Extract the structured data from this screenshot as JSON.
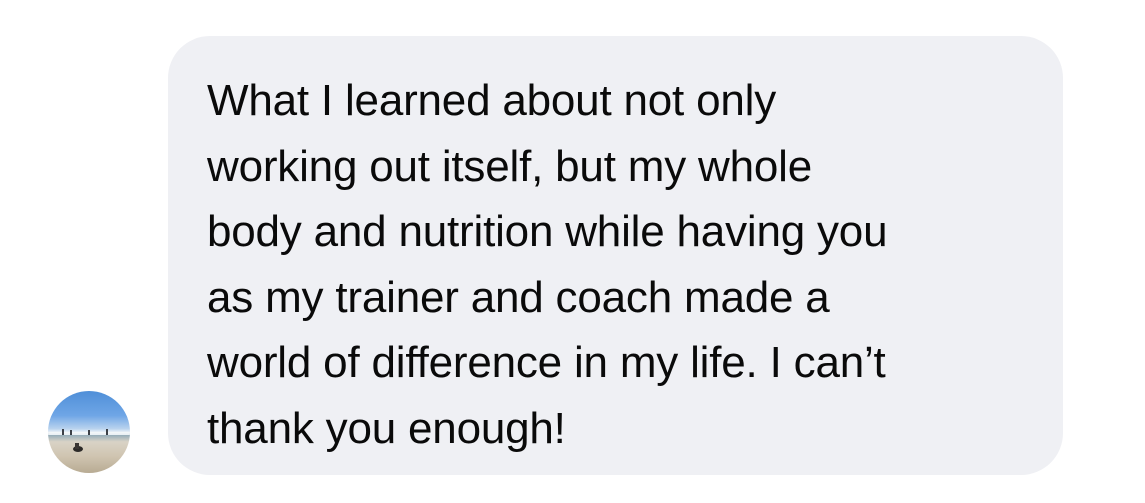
{
  "conversation": {
    "messages": [
      {
        "direction": "incoming",
        "avatar_icon": "beach-photo-avatar",
        "text": "What I learned about not only\nworking out itself, but my whole\nbody and nutrition while having you\nas my trainer and coach made a\nworld of difference in my life. I can’t\nthank you enough!"
      }
    ]
  },
  "colors": {
    "background": "#ffffff",
    "bubble": "#eff0f4",
    "text": "#0a0a0a"
  }
}
